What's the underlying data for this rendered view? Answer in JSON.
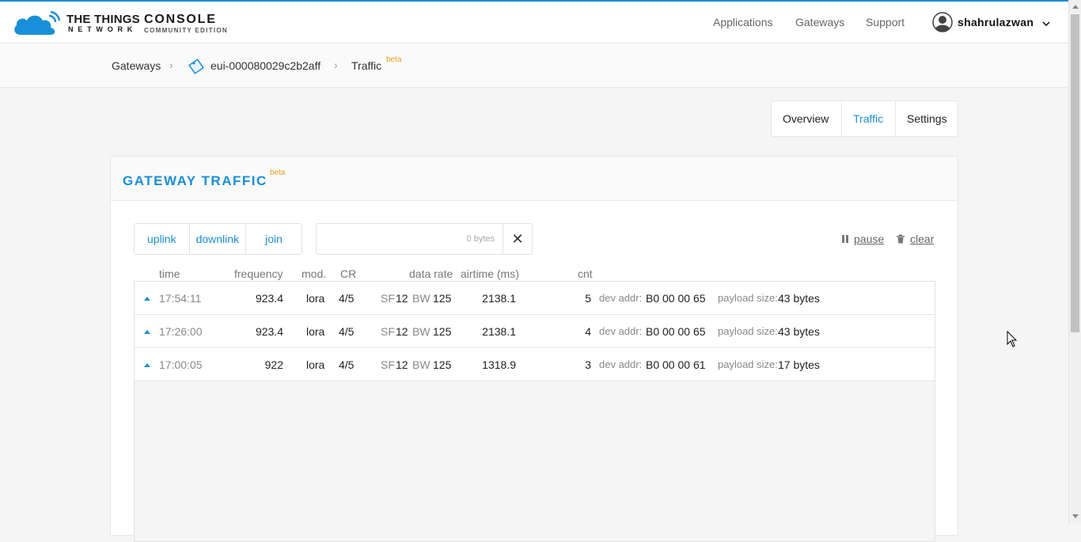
{
  "brand": {
    "name_line1": "THE THINGS",
    "name_line2": "NETWORK",
    "product": "CONSOLE",
    "edition": "COMMUNITY EDITION"
  },
  "nav": {
    "applications": "Applications",
    "gateways": "Gateways",
    "support": "Support"
  },
  "user": {
    "name": "shahrulazwan"
  },
  "breadcrumb": {
    "gateways": "Gateways",
    "gateway_id": "eui-000080029c2b2aff",
    "traffic": "Traffic",
    "beta": "beta"
  },
  "tabs": {
    "overview": "Overview",
    "traffic": "Traffic",
    "settings": "Settings"
  },
  "panel": {
    "title": "GATEWAY TRAFFIC",
    "beta": "beta"
  },
  "filters": {
    "uplink": "uplink",
    "downlink": "downlink",
    "join": "join"
  },
  "search": {
    "placeholder": "0 bytes"
  },
  "actions": {
    "pause": "pause",
    "clear": "clear"
  },
  "columns": {
    "time": "time",
    "frequency": "frequency",
    "mod": "mod.",
    "cr": "CR",
    "data_rate": "data rate",
    "airtime": "airtime (ms)",
    "cnt": "cnt"
  },
  "labels": {
    "sf": "SF",
    "bw": "BW",
    "dev_addr": "dev addr:",
    "payload_size": "payload size:"
  },
  "rows": [
    {
      "time": "17:54:11",
      "frequency": "923.4",
      "mod": "lora",
      "cr": "4/5",
      "sf": "12",
      "bw": "125",
      "airtime": "2138.1",
      "cnt": "5",
      "dev_addr": "B0 00 00 65",
      "payload": "43 bytes"
    },
    {
      "time": "17:26:00",
      "frequency": "923.4",
      "mod": "lora",
      "cr": "4/5",
      "sf": "12",
      "bw": "125",
      "airtime": "2138.1",
      "cnt": "4",
      "dev_addr": "B0 00 00 65",
      "payload": "43 bytes"
    },
    {
      "time": "17:00:05",
      "frequency": "922",
      "mod": "lora",
      "cr": "4/5",
      "sf": "12",
      "bw": "125",
      "airtime": "1318.9",
      "cnt": "3",
      "dev_addr": "B0 00 00 61",
      "payload": "17 bytes"
    }
  ],
  "colors": {
    "accent": "#1a8fd9",
    "beta": "#e8a020"
  }
}
